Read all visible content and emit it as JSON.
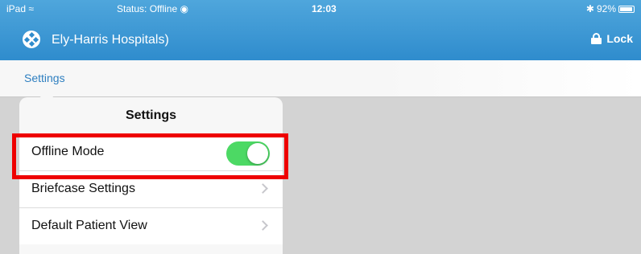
{
  "status_bar": {
    "device": "iPad",
    "wifi_icon": "wifi-icon",
    "status": "Status: Offline",
    "status_icon": "sync-icon",
    "time": "12:03",
    "bluetooth_icon": "bluetooth-icon",
    "battery": "92%"
  },
  "header": {
    "title": "Ely-Harris Hospitals)",
    "logo_icon": "app-logo-icon",
    "lock_label": "Lock",
    "background_color": "#3a97d5"
  },
  "nav": {
    "settings_label": "Settings"
  },
  "popover": {
    "title": "Settings",
    "rows": [
      {
        "label": "Offline Mode",
        "control": "toggle",
        "on": true
      },
      {
        "label": "Briefcase Settings",
        "control": "disclosure"
      },
      {
        "label": "Default Patient View",
        "control": "disclosure"
      }
    ]
  },
  "colors": {
    "toggle_on": "#4cd964",
    "highlight": "#ee0000",
    "link_blue": "#2e7fc0"
  }
}
